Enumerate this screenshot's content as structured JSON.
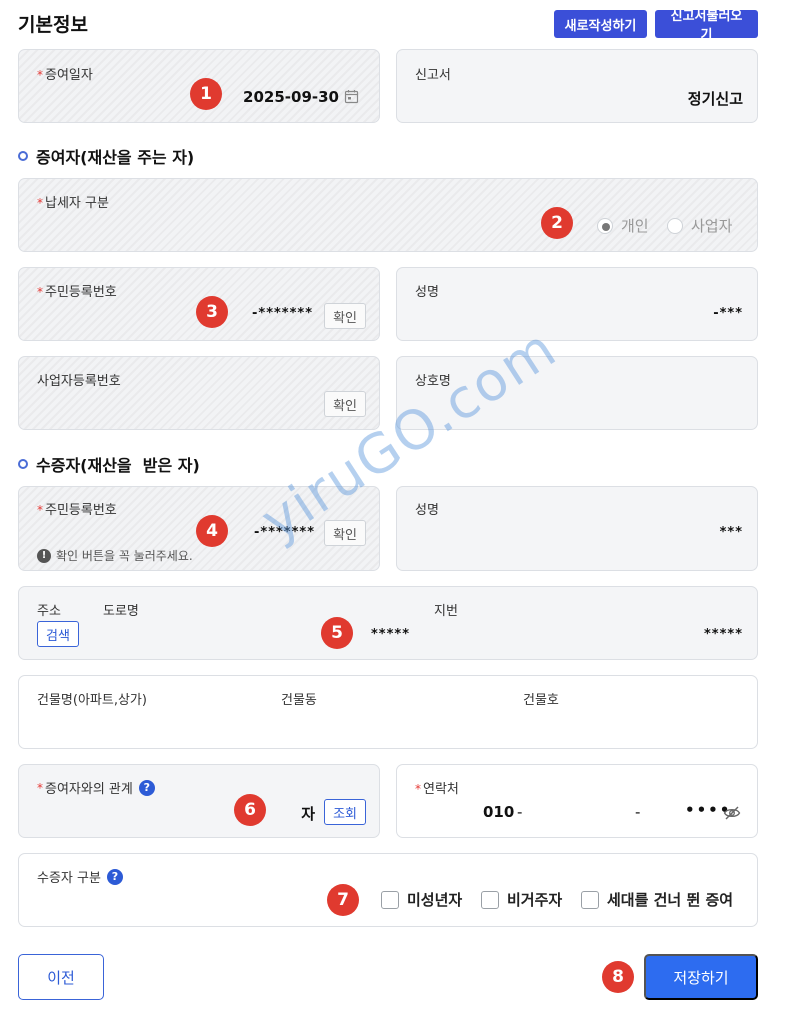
{
  "header": {
    "title": "기본정보",
    "new_button": "새로작성하기",
    "load_button": "신고서불러오기"
  },
  "badges": [
    "1",
    "2",
    "3",
    "4",
    "5",
    "6",
    "7",
    "8"
  ],
  "basic": {
    "gift_date": {
      "required_mark": "*",
      "label": "증여일자",
      "value": "2025-09-30"
    },
    "report": {
      "label": "신고서",
      "value": "정기신고"
    }
  },
  "donor": {
    "section_title": "증여자(재산을 주는 자)",
    "taxpayer_type": {
      "required_mark": "*",
      "label": "납세자 구분",
      "options": [
        "개인",
        "사업자"
      ],
      "selected": "개인"
    },
    "resident_no": {
      "required_mark": "*",
      "label": "주민등록번호",
      "value": "-*******",
      "button": "확인"
    },
    "name": {
      "label": "성명",
      "value": "-***"
    },
    "business_no": {
      "label": "사업자등록번호",
      "button": "확인"
    },
    "company_name": {
      "label": "상호명"
    }
  },
  "donee": {
    "section_title": "수증자(재산을  받은 자)",
    "resident_no": {
      "required_mark": "*",
      "label": "주민등록번호",
      "value": "-*******",
      "button": "확인",
      "notice": "확인 버튼을 꼭 눌러주세요."
    },
    "name": {
      "label": "성명",
      "value": "***"
    },
    "address": {
      "label": "주소",
      "road_label": "도로명",
      "lot_label": "지번",
      "search_button": "검색",
      "road_value": "*****",
      "lot_value": "*****"
    },
    "building": {
      "name_label": "건물명(아파트,상가)",
      "dong_label": "건물동",
      "ho_label": "건물호"
    },
    "relation": {
      "required_mark": "*",
      "label": "증여자와의 관계",
      "help": "?",
      "value": "자",
      "button": "조회"
    },
    "contact": {
      "required_mark": "*",
      "label": "연락처",
      "prefix": "010",
      "sep1": "-",
      "sep2": "-",
      "last": "••••"
    },
    "donee_type": {
      "label": "수증자 구분",
      "help": "?",
      "options": [
        "미성년자",
        "비거주자",
        "세대를 건너 뛴 증여"
      ]
    }
  },
  "footer": {
    "prev_button": "이전",
    "save_button": "저장하기"
  },
  "watermark": "yiruGO.com",
  "colors": {
    "primary": "#2d6cf0",
    "header_button": "#3b4fd8",
    "badge": "#e03a2f",
    "required": "#e53935"
  }
}
